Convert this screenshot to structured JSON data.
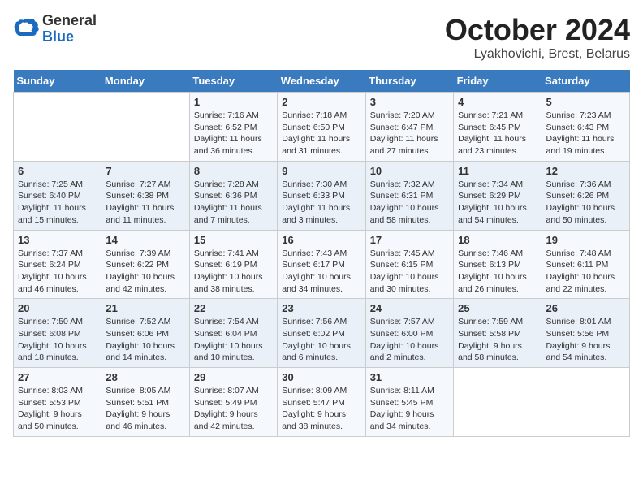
{
  "header": {
    "logo_general": "General",
    "logo_blue": "Blue",
    "month_title": "October 2024",
    "subtitle": "Lyakhovichi, Brest, Belarus"
  },
  "weekdays": [
    "Sunday",
    "Monday",
    "Tuesday",
    "Wednesday",
    "Thursday",
    "Friday",
    "Saturday"
  ],
  "weeks": [
    [
      {
        "day": "",
        "detail": ""
      },
      {
        "day": "",
        "detail": ""
      },
      {
        "day": "1",
        "detail": "Sunrise: 7:16 AM\nSunset: 6:52 PM\nDaylight: 11 hours\nand 36 minutes."
      },
      {
        "day": "2",
        "detail": "Sunrise: 7:18 AM\nSunset: 6:50 PM\nDaylight: 11 hours\nand 31 minutes."
      },
      {
        "day": "3",
        "detail": "Sunrise: 7:20 AM\nSunset: 6:47 PM\nDaylight: 11 hours\nand 27 minutes."
      },
      {
        "day": "4",
        "detail": "Sunrise: 7:21 AM\nSunset: 6:45 PM\nDaylight: 11 hours\nand 23 minutes."
      },
      {
        "day": "5",
        "detail": "Sunrise: 7:23 AM\nSunset: 6:43 PM\nDaylight: 11 hours\nand 19 minutes."
      }
    ],
    [
      {
        "day": "6",
        "detail": "Sunrise: 7:25 AM\nSunset: 6:40 PM\nDaylight: 11 hours\nand 15 minutes."
      },
      {
        "day": "7",
        "detail": "Sunrise: 7:27 AM\nSunset: 6:38 PM\nDaylight: 11 hours\nand 11 minutes."
      },
      {
        "day": "8",
        "detail": "Sunrise: 7:28 AM\nSunset: 6:36 PM\nDaylight: 11 hours\nand 7 minutes."
      },
      {
        "day": "9",
        "detail": "Sunrise: 7:30 AM\nSunset: 6:33 PM\nDaylight: 11 hours\nand 3 minutes."
      },
      {
        "day": "10",
        "detail": "Sunrise: 7:32 AM\nSunset: 6:31 PM\nDaylight: 10 hours\nand 58 minutes."
      },
      {
        "day": "11",
        "detail": "Sunrise: 7:34 AM\nSunset: 6:29 PM\nDaylight: 10 hours\nand 54 minutes."
      },
      {
        "day": "12",
        "detail": "Sunrise: 7:36 AM\nSunset: 6:26 PM\nDaylight: 10 hours\nand 50 minutes."
      }
    ],
    [
      {
        "day": "13",
        "detail": "Sunrise: 7:37 AM\nSunset: 6:24 PM\nDaylight: 10 hours\nand 46 minutes."
      },
      {
        "day": "14",
        "detail": "Sunrise: 7:39 AM\nSunset: 6:22 PM\nDaylight: 10 hours\nand 42 minutes."
      },
      {
        "day": "15",
        "detail": "Sunrise: 7:41 AM\nSunset: 6:19 PM\nDaylight: 10 hours\nand 38 minutes."
      },
      {
        "day": "16",
        "detail": "Sunrise: 7:43 AM\nSunset: 6:17 PM\nDaylight: 10 hours\nand 34 minutes."
      },
      {
        "day": "17",
        "detail": "Sunrise: 7:45 AM\nSunset: 6:15 PM\nDaylight: 10 hours\nand 30 minutes."
      },
      {
        "day": "18",
        "detail": "Sunrise: 7:46 AM\nSunset: 6:13 PM\nDaylight: 10 hours\nand 26 minutes."
      },
      {
        "day": "19",
        "detail": "Sunrise: 7:48 AM\nSunset: 6:11 PM\nDaylight: 10 hours\nand 22 minutes."
      }
    ],
    [
      {
        "day": "20",
        "detail": "Sunrise: 7:50 AM\nSunset: 6:08 PM\nDaylight: 10 hours\nand 18 minutes."
      },
      {
        "day": "21",
        "detail": "Sunrise: 7:52 AM\nSunset: 6:06 PM\nDaylight: 10 hours\nand 14 minutes."
      },
      {
        "day": "22",
        "detail": "Sunrise: 7:54 AM\nSunset: 6:04 PM\nDaylight: 10 hours\nand 10 minutes."
      },
      {
        "day": "23",
        "detail": "Sunrise: 7:56 AM\nSunset: 6:02 PM\nDaylight: 10 hours\nand 6 minutes."
      },
      {
        "day": "24",
        "detail": "Sunrise: 7:57 AM\nSunset: 6:00 PM\nDaylight: 10 hours\nand 2 minutes."
      },
      {
        "day": "25",
        "detail": "Sunrise: 7:59 AM\nSunset: 5:58 PM\nDaylight: 9 hours\nand 58 minutes."
      },
      {
        "day": "26",
        "detail": "Sunrise: 8:01 AM\nSunset: 5:56 PM\nDaylight: 9 hours\nand 54 minutes."
      }
    ],
    [
      {
        "day": "27",
        "detail": "Sunrise: 8:03 AM\nSunset: 5:53 PM\nDaylight: 9 hours\nand 50 minutes."
      },
      {
        "day": "28",
        "detail": "Sunrise: 8:05 AM\nSunset: 5:51 PM\nDaylight: 9 hours\nand 46 minutes."
      },
      {
        "day": "29",
        "detail": "Sunrise: 8:07 AM\nSunset: 5:49 PM\nDaylight: 9 hours\nand 42 minutes."
      },
      {
        "day": "30",
        "detail": "Sunrise: 8:09 AM\nSunset: 5:47 PM\nDaylight: 9 hours\nand 38 minutes."
      },
      {
        "day": "31",
        "detail": "Sunrise: 8:11 AM\nSunset: 5:45 PM\nDaylight: 9 hours\nand 34 minutes."
      },
      {
        "day": "",
        "detail": ""
      },
      {
        "day": "",
        "detail": ""
      }
    ]
  ]
}
